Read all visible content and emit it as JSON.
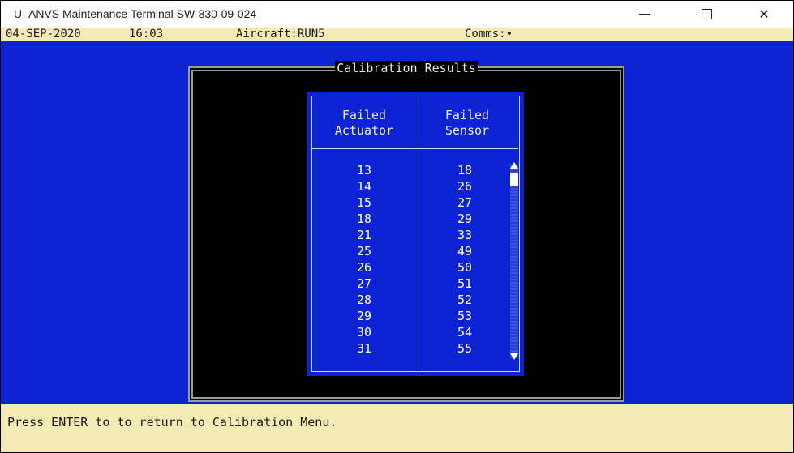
{
  "window": {
    "app_icon": "U",
    "title": "ANVS Maintenance Terminal SW-830-09-024",
    "controls": {
      "close": "✕"
    }
  },
  "status_bar": {
    "date": "04-SEP-2020",
    "time": "16:03",
    "aircraft": "Aircraft:RUN5",
    "comms": "Comms:•"
  },
  "dialog": {
    "title": "Calibration Results",
    "headers": {
      "failed_actuator": [
        "Failed",
        "Actuator"
      ],
      "failed_sensor": [
        "Failed",
        "Sensor"
      ]
    },
    "rows": [
      [
        "13",
        "18"
      ],
      [
        "14",
        "26"
      ],
      [
        "15",
        "27"
      ],
      [
        "18",
        "29"
      ],
      [
        "21",
        "33"
      ],
      [
        "25",
        "49"
      ],
      [
        "26",
        "50"
      ],
      [
        "27",
        "51"
      ],
      [
        "28",
        "52"
      ],
      [
        "29",
        "53"
      ],
      [
        "30",
        "54"
      ],
      [
        "31",
        "55"
      ]
    ]
  },
  "footer": {
    "message": "Press ENTER to to return to Calibration Menu."
  },
  "colors": {
    "screen_background": "#0c23d4",
    "status_bar": "#f4eab4",
    "dialog_background": "#000000",
    "text_light": "#ffffff"
  },
  "icons": [
    "app-icon",
    "minimize-icon",
    "maximize-icon",
    "close-icon",
    "scroll-up-arrow-icon",
    "scroll-down-arrow-icon"
  ]
}
